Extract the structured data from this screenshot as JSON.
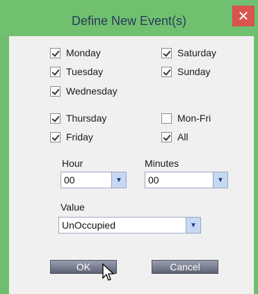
{
  "dialog": {
    "title": "Define New Event(s)",
    "close_symbol": "✕"
  },
  "days": {
    "monday": {
      "label": "Monday",
      "checked": true
    },
    "tuesday": {
      "label": "Tuesday",
      "checked": true
    },
    "wednesday": {
      "label": "Wednesday",
      "checked": true
    },
    "thursday": {
      "label": "Thursday",
      "checked": true
    },
    "friday": {
      "label": "Friday",
      "checked": true
    },
    "saturday": {
      "label": "Saturday",
      "checked": true
    },
    "sunday": {
      "label": "Sunday",
      "checked": true
    },
    "monfri": {
      "label": "Mon-Fri",
      "checked": false
    },
    "all": {
      "label": "All",
      "checked": true
    }
  },
  "hour": {
    "label": "Hour",
    "value": "00"
  },
  "minutes": {
    "label": "Minutes",
    "value": "00"
  },
  "value": {
    "label": "Value",
    "selected": "UnOccupied"
  },
  "buttons": {
    "ok": "OK",
    "cancel": "Cancel"
  },
  "colors": {
    "titlebar": "#70c070",
    "close": "#d9534f",
    "dropdown": "#c6d8f2"
  }
}
